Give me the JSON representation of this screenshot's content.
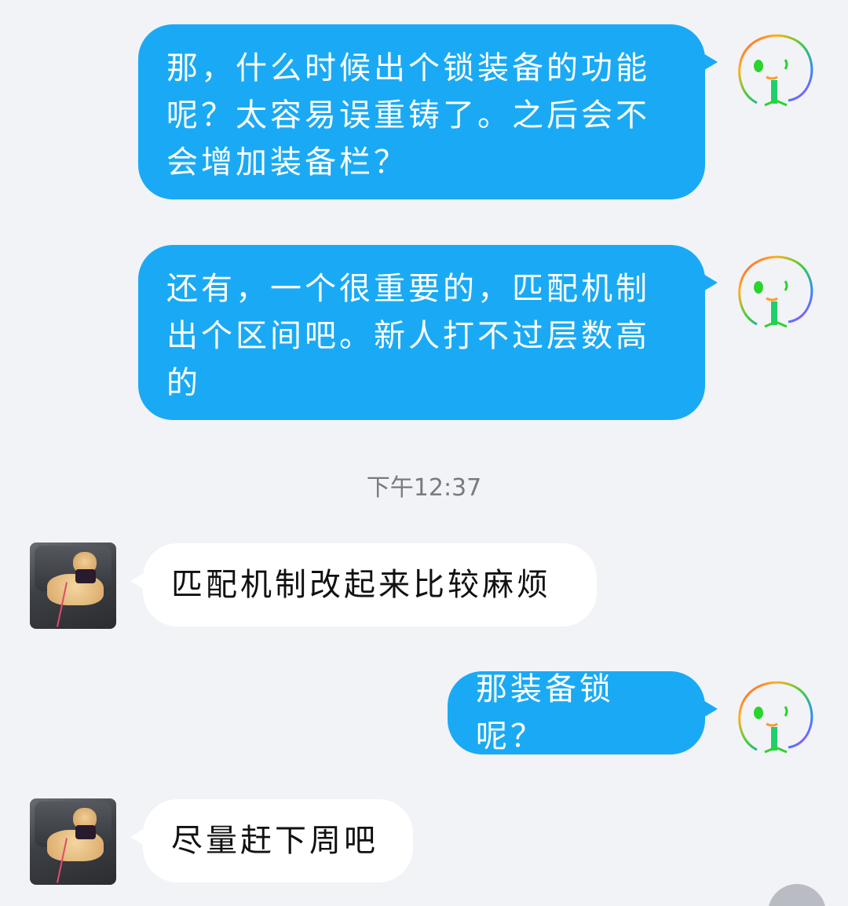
{
  "conversation": {
    "messages": [
      {
        "direction": "out",
        "text": "那，什么时候出个锁装备的功能呢？太容易误重铸了。之后会不会增加装备栏？"
      },
      {
        "direction": "out",
        "text": "还有，一个很重要的，匹配机制出个区间吧。新人打不过层数高的"
      },
      {
        "direction": "timestamp",
        "text": "下午12:37"
      },
      {
        "direction": "in",
        "text": "匹配机制改起来比较麻烦"
      },
      {
        "direction": "out",
        "text": "那装备锁呢？"
      },
      {
        "direction": "in",
        "text": "尽量赶下周吧"
      }
    ]
  },
  "avatars": {
    "self_icon": "rainbow-doodle-face-icon",
    "other_icon": "cat-photo-avatar"
  },
  "colors": {
    "background": "#f2f3f7",
    "outgoing_bubble": "#1aaaf5",
    "incoming_bubble": "#ffffff",
    "timestamp": "#777a80"
  }
}
